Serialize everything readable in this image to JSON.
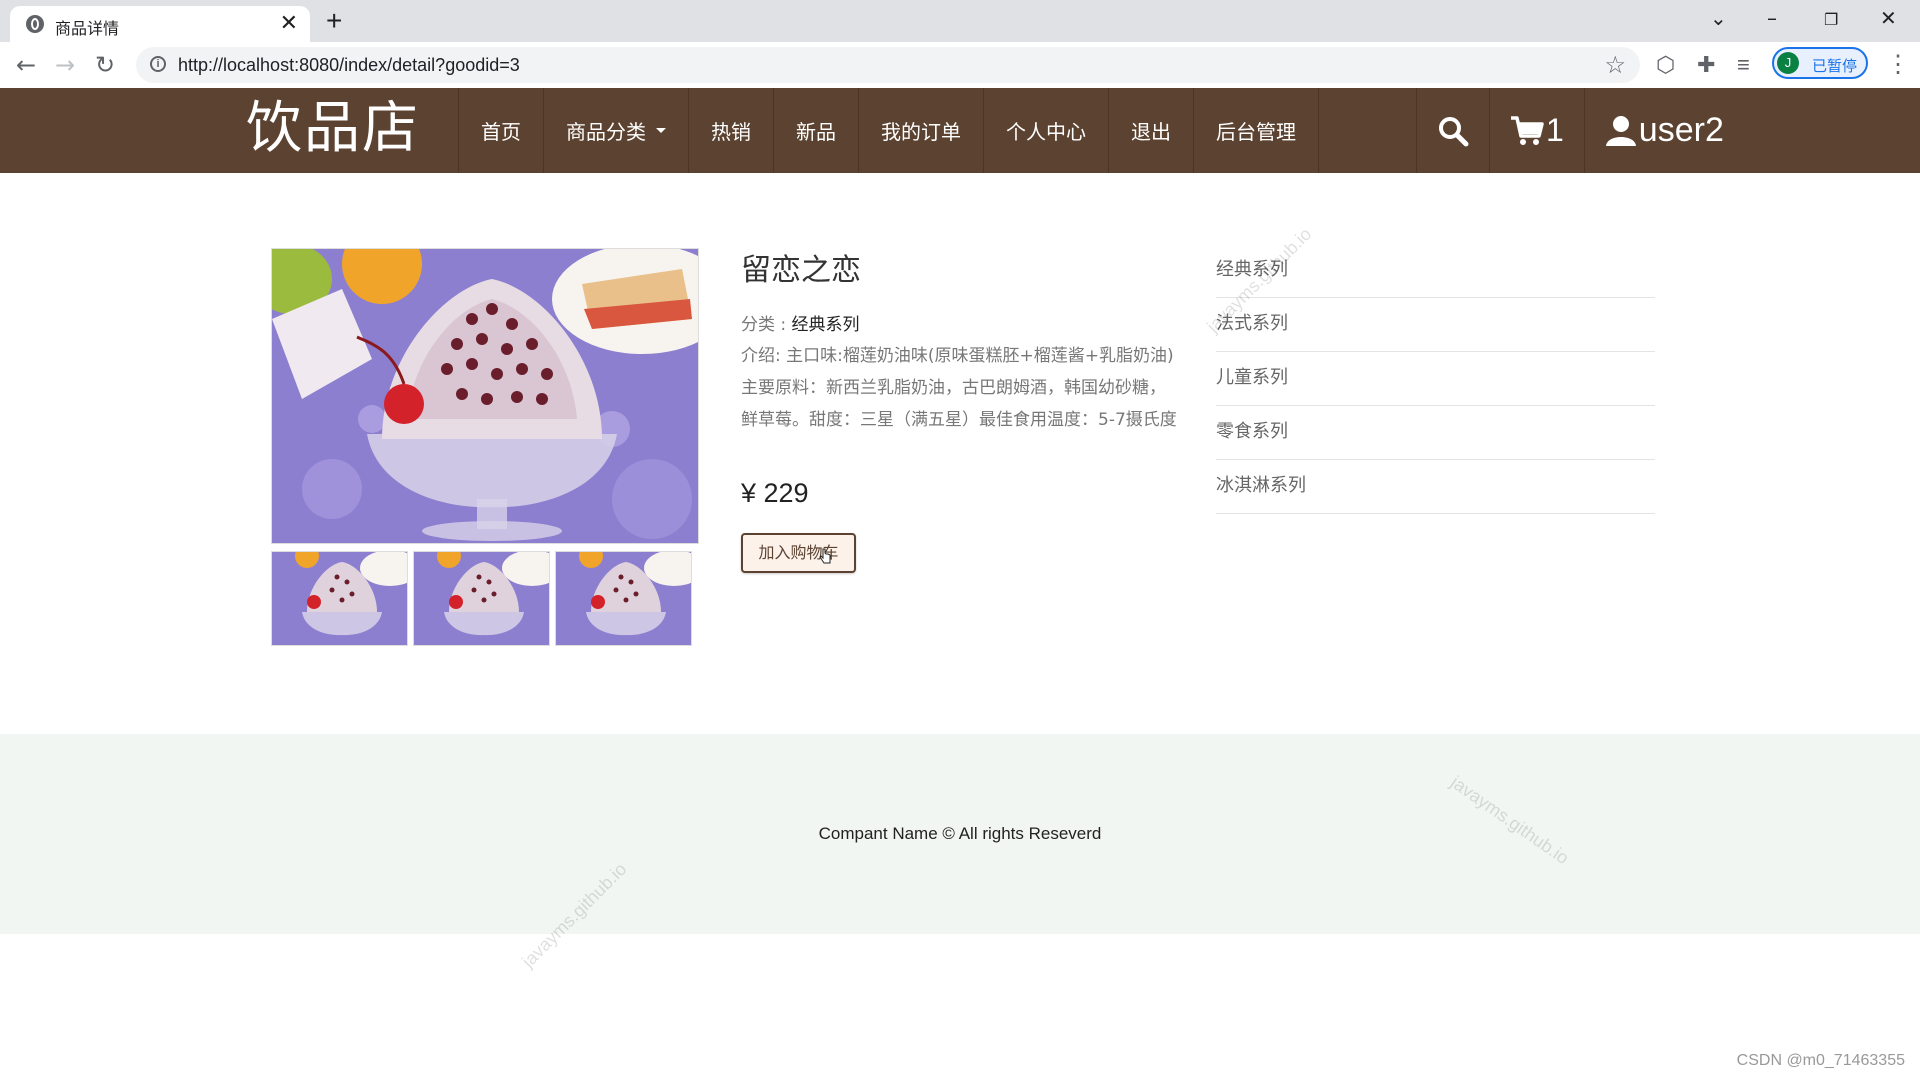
{
  "browser": {
    "tab_title": "商品详情",
    "tab_close": "✕",
    "new_tab": "+",
    "url": "http://localhost:8080/index/detail?goodid=3",
    "profile_initial": "J",
    "profile_status": "已暂停"
  },
  "site": {
    "logo": "饮品店",
    "nav": [
      {
        "label": "首页"
      },
      {
        "label": "商品分类"
      },
      {
        "label": "热销"
      },
      {
        "label": "新品"
      },
      {
        "label": "我的订单"
      },
      {
        "label": "个人中心"
      },
      {
        "label": "退出"
      },
      {
        "label": "后台管理"
      }
    ],
    "cart_count": "1",
    "username": "user2"
  },
  "product": {
    "title": "留恋之恋",
    "category_label": "分类 : ",
    "category_value": "经典系列",
    "intro": "介绍: 主口味:榴莲奶油味(原味蛋糕胚+榴莲酱+乳脂奶油) 主要原料：新西兰乳脂奶油，古巴朗姆酒，韩国幼砂糖，鲜草莓。甜度：三星（满五星）最佳食用温度：5-7摄氏度",
    "price": "¥ 229",
    "add_to_cart": "加入购物车"
  },
  "categories": [
    {
      "label": "经典系列"
    },
    {
      "label": "法式系列"
    },
    {
      "label": "儿童系列"
    },
    {
      "label": "零食系列"
    },
    {
      "label": "冰淇淋系列"
    }
  ],
  "footer": {
    "text": "Compant Name © All rights Reseverd"
  },
  "watermark": "javayms.github.io",
  "csdn_mark": "CSDN @m0_71463355"
}
